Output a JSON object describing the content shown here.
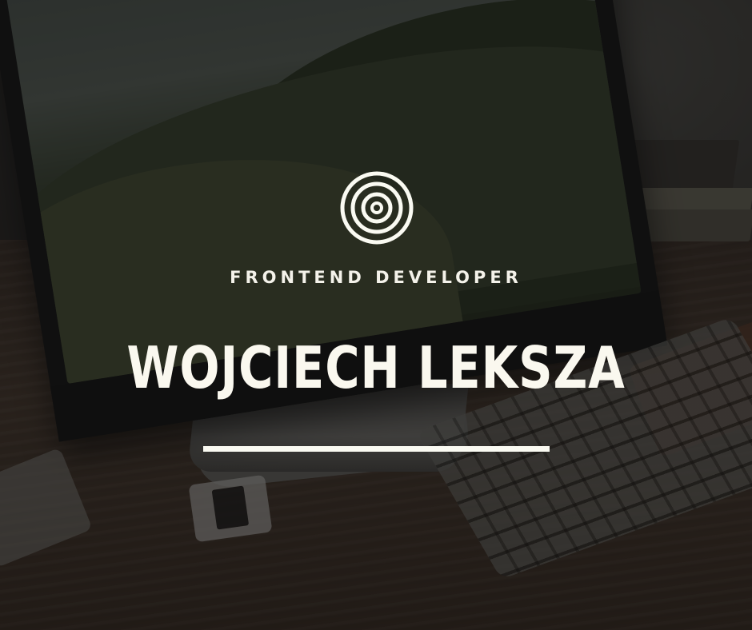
{
  "subtitle": "FRONTEND DEVELOPER",
  "name": "WOJCIECH LEKSZA",
  "logo": {
    "icon": "concentric-target-icon",
    "color": "#fafaf2"
  },
  "colors": {
    "text": "#fafaf2",
    "overlay": "#0f0f0f"
  }
}
